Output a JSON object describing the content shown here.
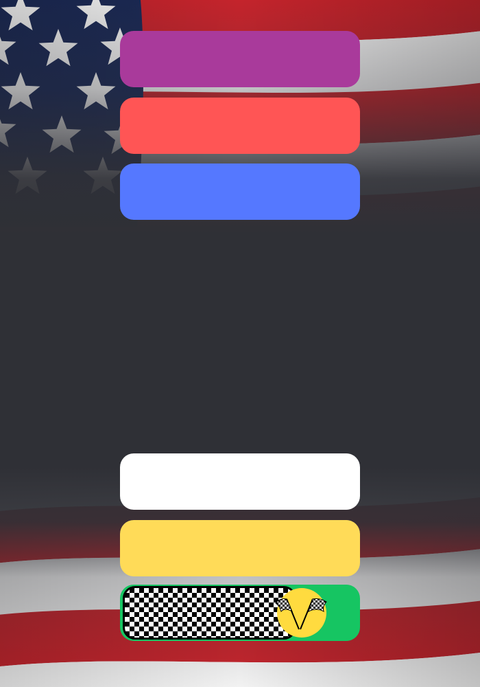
{
  "background": {
    "description_icon": "american-flag-icon",
    "colors": {
      "flag_red": "#c4242c",
      "flag_white": "#f2f2f2",
      "flag_blue": "#1c2a55",
      "overlay_dark": "#2f3036"
    }
  },
  "buttons": [
    {
      "label": "",
      "color": "#a93a9b"
    },
    {
      "label": "",
      "color": "#ff5555"
    },
    {
      "label": "",
      "color": "#5578ff"
    },
    {
      "label": "",
      "color": "#ffffff"
    },
    {
      "label": "",
      "color": "#ffdb58"
    }
  ],
  "slider": {
    "progress": 0.78,
    "track_color": "#16c562",
    "knob_color": "#ffdb3f",
    "knob_icon": "checkered-flags-icon",
    "fill_pattern": "checkered"
  }
}
